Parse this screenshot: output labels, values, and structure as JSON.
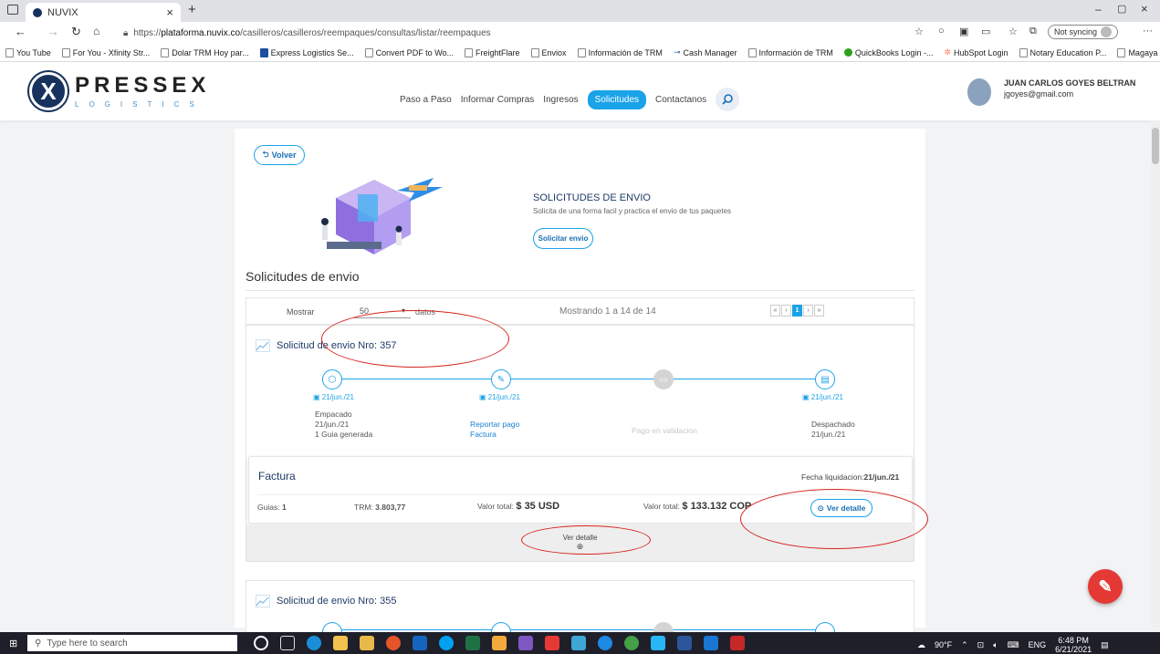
{
  "browser": {
    "tab_title": "NUVIX",
    "tab_close": "×",
    "new_tab": "+",
    "url_prefix": "https://",
    "url_host": "plataforma.nuvix.co",
    "url_path": "/casilleros/casilleros/reempaques/consultas/listar/reempaques",
    "sync_label": "Not syncing",
    "more": "···",
    "bookmarks": [
      "You Tube",
      "For You - Xfinity Str...",
      "Dolar TRM Hoy par...",
      "Express Logistics Se...",
      "Convert PDF to Wo...",
      "FreightFlare",
      "Enviox",
      "Información de TRM",
      "Cash Manager",
      "Información de TRM",
      "QuickBooks Login -...",
      "HubSpot Login",
      "Notary Education P...",
      "Magaya Transaction..."
    ]
  },
  "site": {
    "logo_letter": "X",
    "logo_main": "PRESSEX",
    "logo_sub": "LOGISTICS",
    "nav": [
      "Paso a Paso",
      "Informar Compras",
      "Ingresos",
      "Solicitudes",
      "Contactanos"
    ],
    "user_name": "JUAN CARLOS GOYES BELTRAN",
    "user_email": "jgoyes@gmail.com"
  },
  "page": {
    "back_label": "Volver",
    "hero_title": "SOLICITUDES DE ENVIO",
    "hero_subtitle": "Solicita de una forma facil y practica el envio de tus paquetes",
    "request_label": "Solicitar envio",
    "section_title": "Solicitudes de envio",
    "show_label": "Mostrar",
    "page_size": "50",
    "datos_label": "datos",
    "showing_text": "Mostrando 1 a 14 de 14",
    "current_page": "1"
  },
  "cards": [
    {
      "title": "Solicitud de envio Nro: 357",
      "steps": [
        {
          "date": "21/jun./21",
          "lines": [
            "Empacado",
            "21/jun./21",
            "1 Guia generada"
          ]
        },
        {
          "date": "21/jun./21",
          "links": [
            "Reportar pago",
            "Factura"
          ]
        },
        {
          "date": "",
          "lines": [
            "Pago en validacion"
          ]
        },
        {
          "date": "21/jun./21",
          "lines": [
            "Despachado",
            "21/jun./21"
          ]
        }
      ],
      "invoice": {
        "title": "Factura",
        "liq_label": "Fecha liquidacion:",
        "liq_date": "21/jun./21",
        "guias_label": "Guias:",
        "guias": "1",
        "trm_label": "TRM:",
        "trm": "3.803,77",
        "usd_label": "Valor total:",
        "usd": "$ 35 USD",
        "cop_label": "Valor total:",
        "cop": "$ 133.132 COP",
        "detail_button": "Ver detalle"
      },
      "detail_bar": "Ver detalle"
    },
    {
      "title": "Solicitud de envio Nro: 355"
    }
  ],
  "taskbar": {
    "search_placeholder": "Type here to search",
    "weather": "90°F",
    "lang": "ENG",
    "time": "6:48 PM",
    "date": "6/21/2021"
  }
}
